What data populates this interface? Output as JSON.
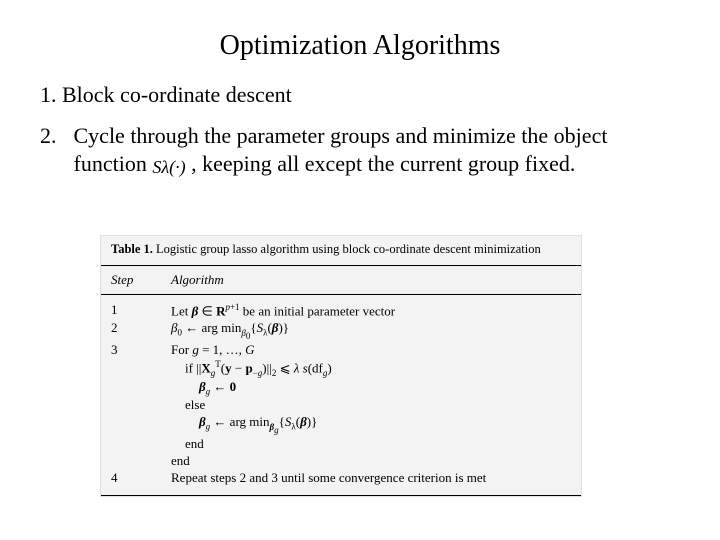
{
  "title": "Optimization Algorithms",
  "item1_num": "1.",
  "item1_text": "Block co-ordinate descent",
  "item2_num": "2.",
  "item2_textA": "Cycle through the parameter groups and minimize the object function ",
  "item2_math": "Sλ(·)",
  "item2_textB": " , keeping all except the current group fixed.",
  "fig": {
    "caption_label": "Table 1.",
    "caption_text": " Logistic group lasso algorithm using block co-ordinate descent minimization",
    "head_step": "Step",
    "head_alg": "Algorithm",
    "rows": [
      {
        "step": "1",
        "indent": 0,
        "html": "Let <span class='bi'>β</span> ∈ <span class='bb'>R</span><sup><span class='it'>p</span>+1</sup> be an initial parameter vector"
      },
      {
        "step": "2",
        "indent": 0,
        "html": "<span class='it'>β</span><sub>0</sub> ← arg&nbsp;min<sub><span class='it'>β</span><sub>0</sub></sub>{<span class='it'>S</span><sub>λ</sub>(<span class='bi'>β</span>)}"
      },
      {
        "step": "3",
        "indent": 0,
        "html": "For <span class='it'>g</span> = 1, …, <span class='it'>G</span>"
      },
      {
        "step": "",
        "indent": 1,
        "html": "if ||<span class='bb'>X</span><sub><span class='it'>g</span></sub><sup>T</sup>(<span class='bb'>y</span> − <span class='bb'>p</span><sub>−<span class='it'>g</span></sub>)||<sub>2</sub> ⩽ <span class='it'>λ s</span>(df<sub><span class='it'>g</span></sub>)"
      },
      {
        "step": "",
        "indent": 2,
        "html": "<span class='bi'>β</span><sub><span class='it'>g</span></sub> ← <span class='bb'>0</span>"
      },
      {
        "step": "",
        "indent": 1,
        "html": "else"
      },
      {
        "step": "",
        "indent": 2,
        "html": "<span class='bi'>β</span><sub><span class='it'>g</span></sub> ← arg&nbsp;min<sub><span class='bi'>β</span><sub><span class='it'>g</span></sub></sub>{<span class='it'>S</span><sub>λ</sub>(<span class='bi'>β</span>)}"
      },
      {
        "step": "",
        "indent": 1,
        "html": "end"
      },
      {
        "step": "",
        "indent": 0,
        "html": "end"
      },
      {
        "step": "4",
        "indent": 0,
        "html": "Repeat steps 2 and 3 until some convergence criterion is met"
      }
    ]
  }
}
